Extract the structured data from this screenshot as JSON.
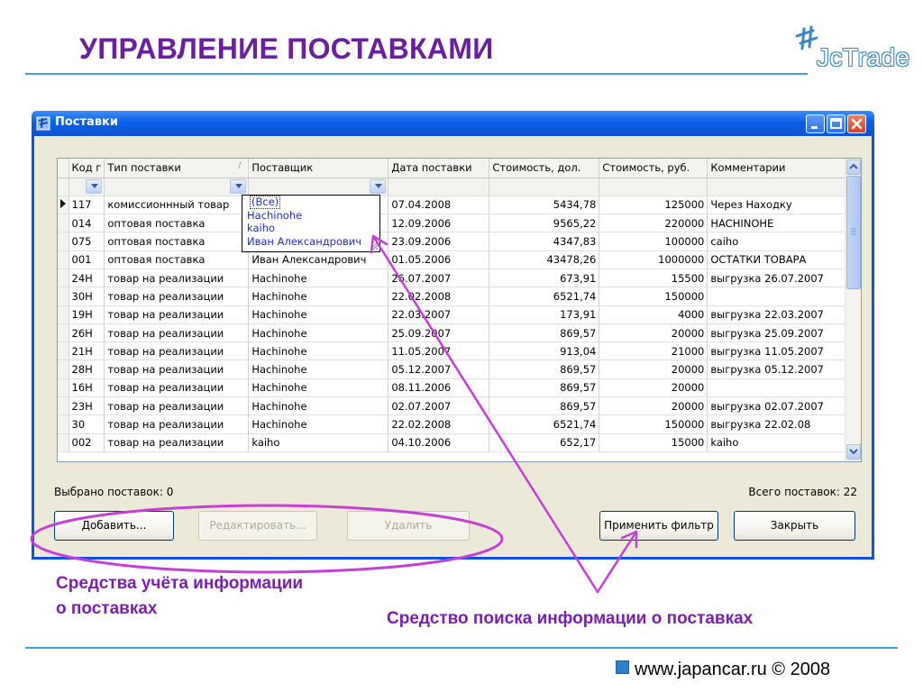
{
  "slide": {
    "title": "УПРАВЛЕНИЕ ПОСТАВКАМИ",
    "logo_text": "JcTrade",
    "caption_left_line1": "Средства учёта информации",
    "caption_left_line2": "о поставках",
    "caption_right": "Средство поиска информации о поставках",
    "footer": "www.japancar.ru © 2008"
  },
  "window": {
    "title": "Поставки",
    "status_selected": "Выбрано поставок: 0",
    "status_total": "Всего поставок: 22"
  },
  "grid": {
    "columns": [
      "Код г",
      "Тип поставки",
      "Поставщик",
      "Дата поставки",
      "Стоимость, дол.",
      "Стоимость, руб.",
      "Комментарии"
    ],
    "rows": [
      [
        "117",
        "комиссионнный товар",
        "",
        "07.04.2008",
        "5434,78",
        "125000",
        "Через Находку"
      ],
      [
        "014",
        "оптовая поставка",
        "",
        "12.09.2006",
        "9565,22",
        "220000",
        "HACHINOHE"
      ],
      [
        "075",
        "оптовая поставка",
        "",
        "23.09.2006",
        "4347,83",
        "100000",
        "caiho"
      ],
      [
        "001",
        "оптовая поставка",
        "Иван Александрович",
        "01.05.2006",
        "43478,26",
        "1000000",
        "ОСТАТКИ ТОВАРА"
      ],
      [
        "24Н",
        "товар на реализации",
        "Hachinohe",
        "26.07.2007",
        "673,91",
        "15500",
        "выгрузка 26.07.2007"
      ],
      [
        "30Н",
        "товар на реализации",
        "Hachinohe",
        "22.02.2008",
        "6521,74",
        "150000",
        ""
      ],
      [
        "19Н",
        "товар на реализации",
        "Hachinohe",
        "22.03.2007",
        "173,91",
        "4000",
        "выгрузка 22.03.2007"
      ],
      [
        "26Н",
        "товар на реализации",
        "Hachinohe",
        "25.09.2007",
        "869,57",
        "20000",
        "выгрузка 25.09.2007"
      ],
      [
        "21Н",
        "товар на реализации",
        "Hachinohe",
        "11.05.2007",
        "913,04",
        "21000",
        "выгрузка 11.05.2007"
      ],
      [
        "28Н",
        "товар на реализации",
        "Hachinohe",
        "05.12.2007",
        "869,57",
        "20000",
        "выгрузка 05.12.2007"
      ],
      [
        "16Н",
        "товар на реализации",
        "Hachinohe",
        "08.11.2006",
        "869,57",
        "20000",
        ""
      ],
      [
        "23Н",
        "товар на реализации",
        "Hachinohe",
        "02.07.2007",
        "869,57",
        "20000",
        "выгрузка 02.07.2007"
      ],
      [
        "30",
        "товар на реализации",
        "Hachinohe",
        "22.02.2008",
        "6521,74",
        "150000",
        "выгрузка 22.02.08"
      ],
      [
        "002",
        "товар на реализации",
        "kaiho",
        "04.10.2006",
        "652,17",
        "15000",
        "kaiho"
      ]
    ],
    "dropdown_options": [
      "(Все)",
      "Hachinohe",
      "kaiho",
      "Иван Александрович"
    ]
  },
  "buttons": {
    "add": "Добавить...",
    "edit": "Редактировать...",
    "delete": "Удалить",
    "apply_filter": "Применить фильтр",
    "close": "Закрыть"
  },
  "colors": {
    "title_purple": "#6b1fa0",
    "annotation_purple": "#c53fd6",
    "xp_blue": "#0a54e0",
    "rule_blue": "#3aa2dc"
  }
}
